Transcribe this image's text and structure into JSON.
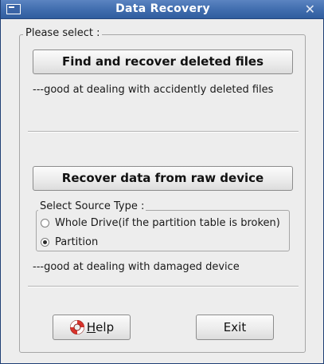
{
  "window": {
    "title": "Data Recovery",
    "close_glyph": "✕"
  },
  "main": {
    "frame_label": "Please select :",
    "find_button_label": "Find and recover deleted files",
    "find_description": "---good at dealing with accidently deleted files",
    "raw_button_label": "Recover data from raw device",
    "source_group": {
      "label": "Select Source Type :",
      "options": [
        {
          "label": "Whole Drive(if the partition table is broken)",
          "selected": false
        },
        {
          "label": "Partition",
          "selected": true
        }
      ]
    },
    "raw_description": "---good at dealing with damaged device"
  },
  "footer": {
    "help_mnemonic": "H",
    "help_rest": "elp",
    "help_icon": "lifebuoy-icon",
    "exit_label": "Exit"
  },
  "colors": {
    "titlebar": "#4470b1",
    "background": "#ededed",
    "lifebuoy_red": "#d8322b"
  }
}
